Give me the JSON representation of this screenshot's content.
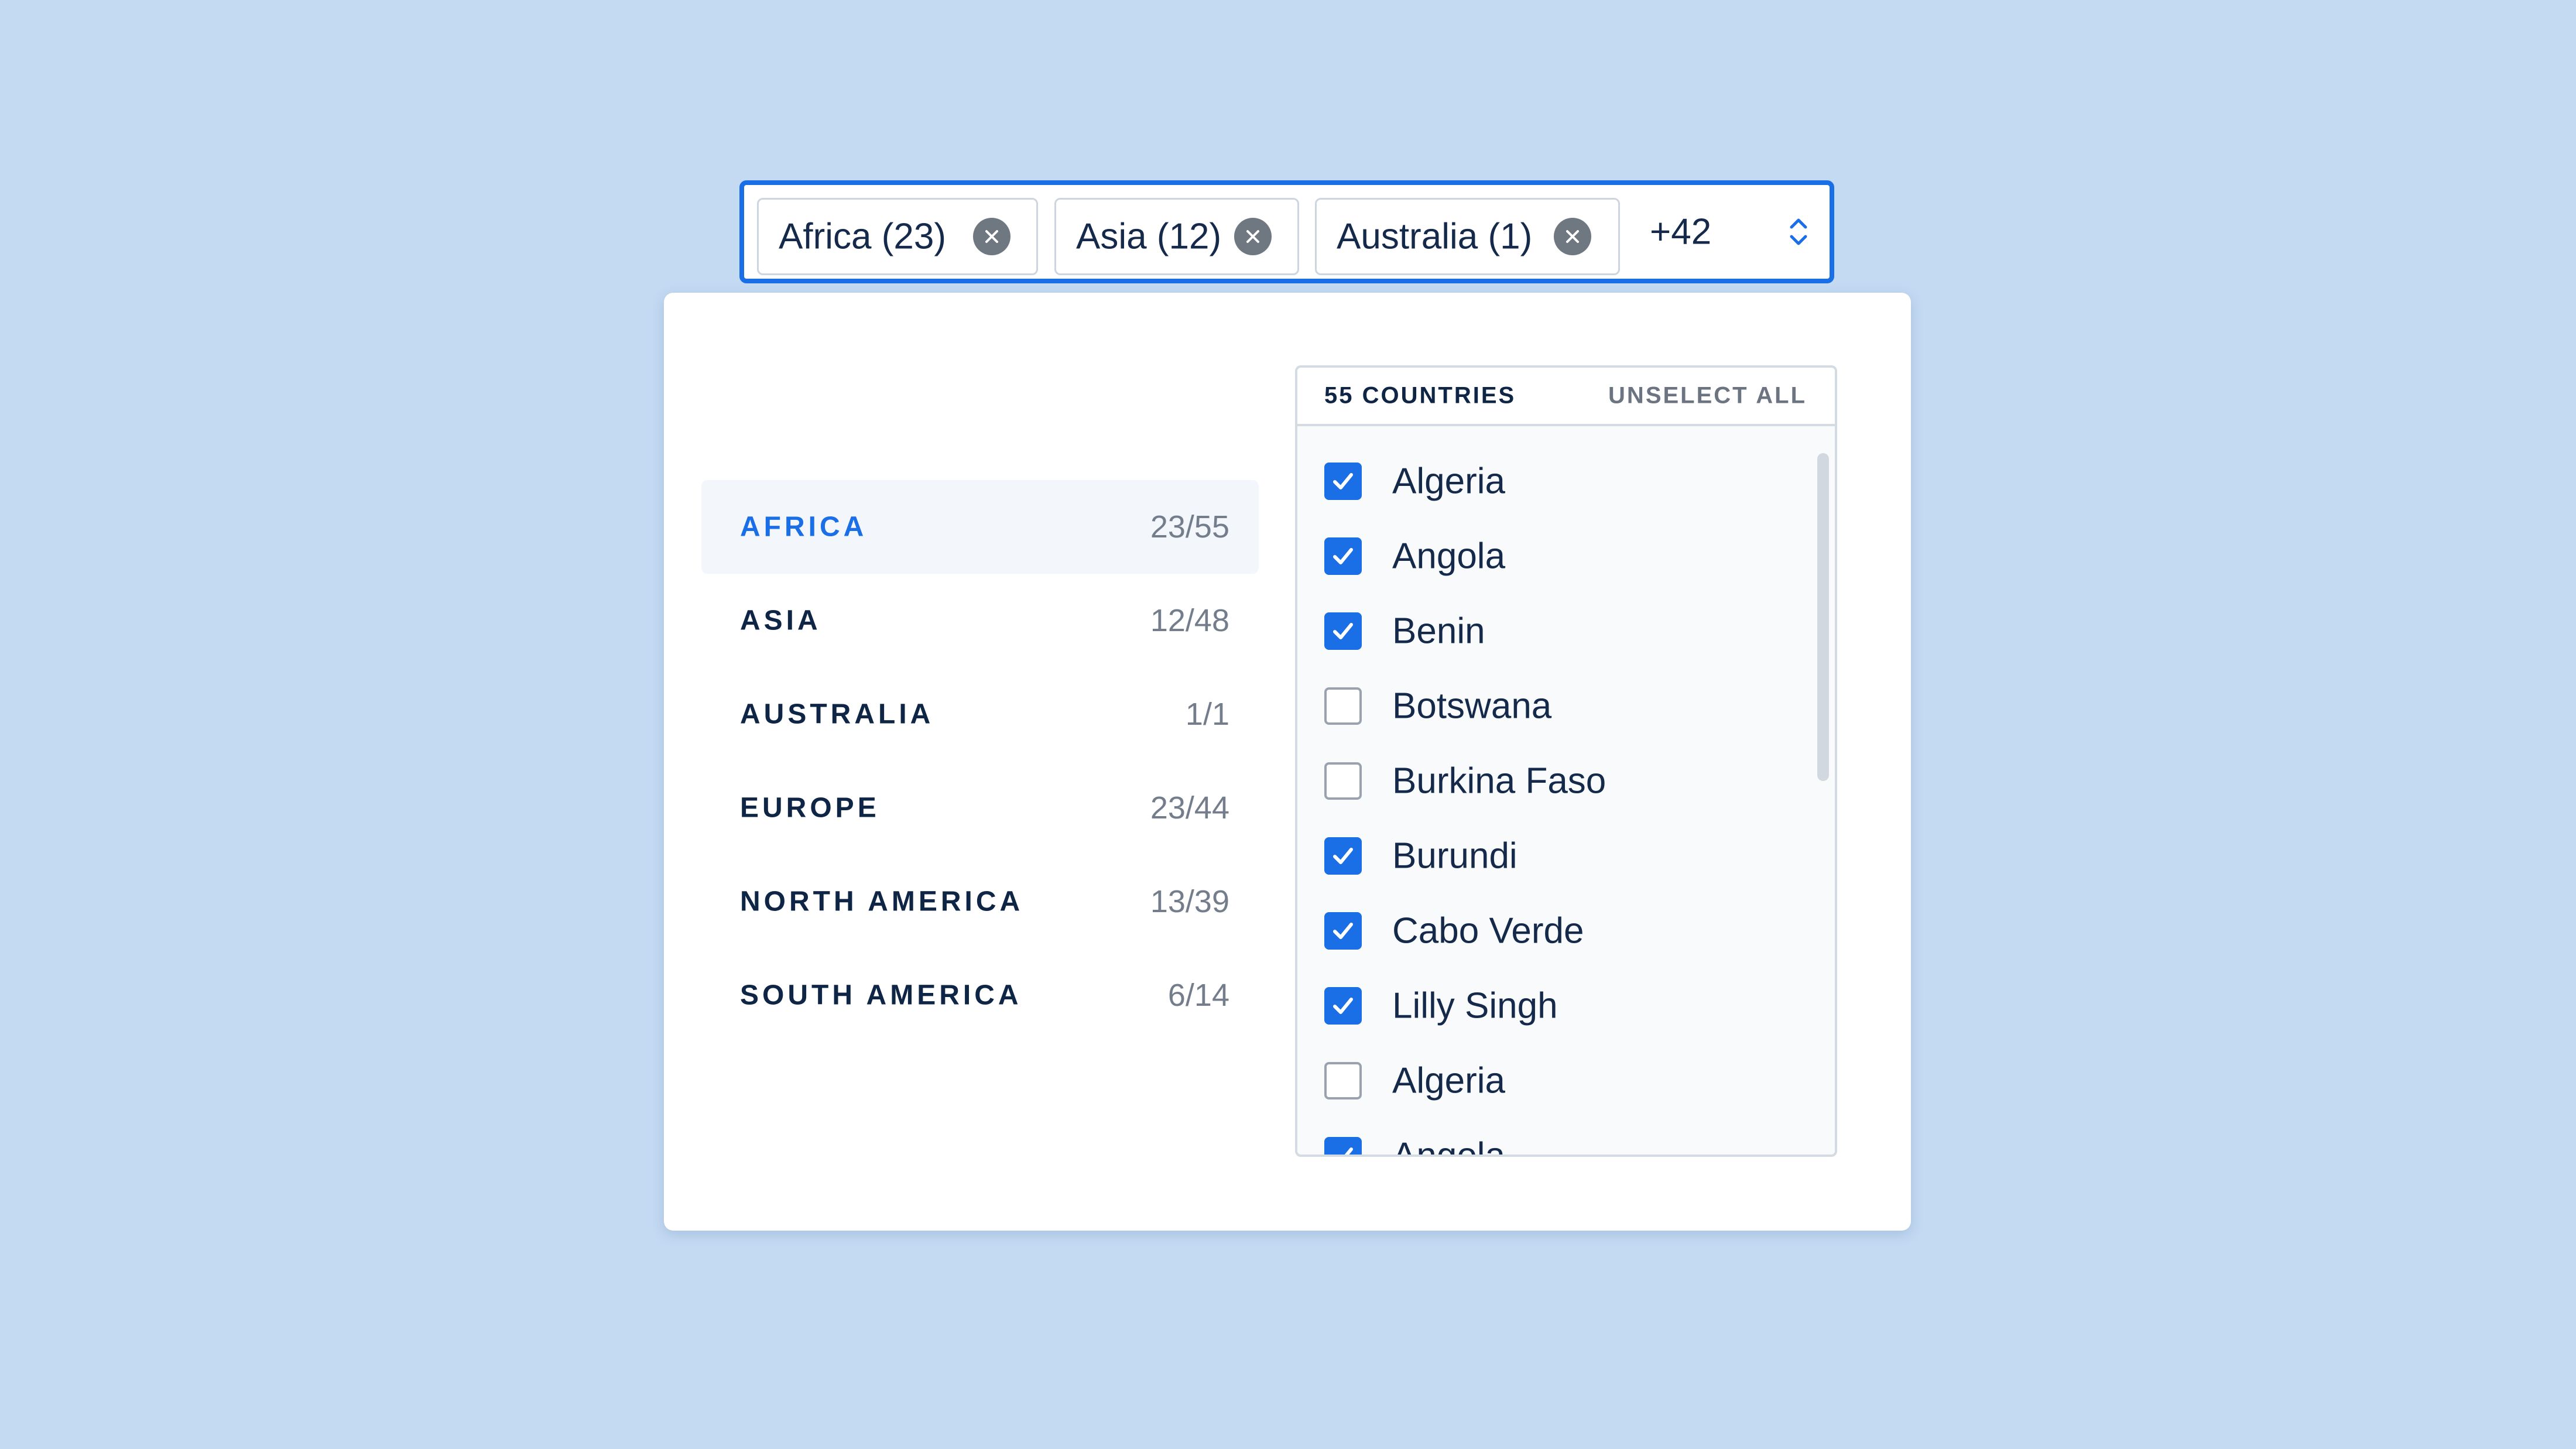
{
  "selected_chips": [
    {
      "label": "Africa (23)",
      "remove_icon": "close-circle-icon"
    },
    {
      "label": "Asia (12)",
      "remove_icon": "close-circle-icon"
    },
    {
      "label": "Australia (1)",
      "remove_icon": "close-circle-icon"
    }
  ],
  "more_count": "+42",
  "toggle_icon": "chevron-up-down-icon",
  "continents": [
    {
      "name": "AFRICA",
      "count": "23/55",
      "active": true
    },
    {
      "name": "ASIA",
      "count": "12/48",
      "active": false
    },
    {
      "name": "AUSTRALIA",
      "count": "1/1",
      "active": false
    },
    {
      "name": "EUROPE",
      "count": "23/44",
      "active": false
    },
    {
      "name": "NORTH AMERICA",
      "count": "13/39",
      "active": false
    },
    {
      "name": "SOUTH AMERICA",
      "count": "6/14",
      "active": false
    }
  ],
  "country_panel": {
    "count_label": "55 COUNTRIES",
    "unselect_all_label": "UNSELECT ALL",
    "countries": [
      {
        "name": "Algeria",
        "checked": true
      },
      {
        "name": "Angola",
        "checked": true
      },
      {
        "name": "Benin",
        "checked": true
      },
      {
        "name": "Botswana",
        "checked": false
      },
      {
        "name": "Burkina Faso",
        "checked": false
      },
      {
        "name": "Burundi",
        "checked": true
      },
      {
        "name": "Cabo Verde",
        "checked": true
      },
      {
        "name": "Lilly Singh",
        "checked": true
      },
      {
        "name": "Algeria",
        "checked": false
      },
      {
        "name": "Angola",
        "checked": true
      }
    ]
  },
  "colors": {
    "background": "#c4daf3",
    "accent": "#1a6ee6",
    "text": "#0f2545",
    "muted": "#737d8b"
  }
}
